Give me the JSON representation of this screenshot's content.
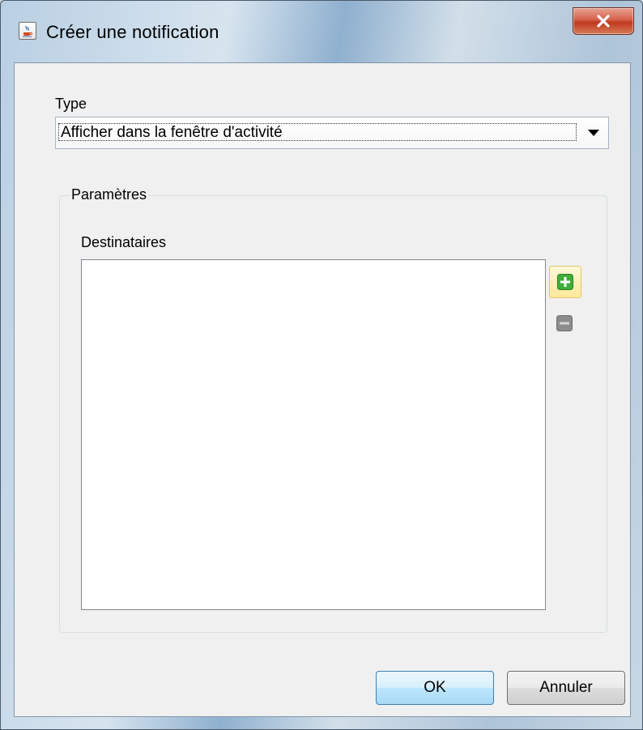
{
  "window": {
    "title": "Créer une notification",
    "close_symbol": "X"
  },
  "type_field": {
    "label": "Type",
    "selected": "Afficher dans la fenêtre d'activité"
  },
  "parameters": {
    "legend": "Paramètres",
    "recipients_label": "Destinataires",
    "recipients": []
  },
  "buttons": {
    "ok": "OK",
    "cancel": "Annuler"
  },
  "colors": {
    "add_icon": "#3fae3a",
    "remove_icon": "#8c8c8c",
    "close_button": "#c7432b"
  },
  "icons": {
    "app": "java-cup-icon",
    "close": "close-icon",
    "dropdown": "chevron-down-icon",
    "add": "plus-icon",
    "remove": "minus-icon"
  }
}
